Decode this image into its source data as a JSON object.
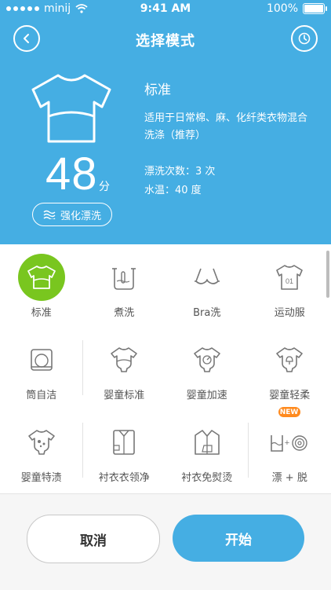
{
  "status_bar": {
    "carrier": "minij",
    "time": "9:41 AM",
    "battery": "100%"
  },
  "header": {
    "title": "选择模式"
  },
  "current_mode": {
    "name": "标准",
    "description": "适用于日常棉、麻、化纤类衣物混合洗涤（推荐）",
    "minutes": "48",
    "minutes_unit": "分",
    "boost_label": "强化漂洗",
    "rinse_count": "漂洗次数：3 次",
    "water_temp": "水温：40 度"
  },
  "modes": [
    {
      "label": "标准",
      "icon": "shirt-icon",
      "selected": true
    },
    {
      "label": "煮洗",
      "icon": "boil-pot-icon"
    },
    {
      "label": "Bra洗",
      "icon": "bra-icon"
    },
    {
      "label": "运动服",
      "icon": "jersey-icon"
    },
    {
      "label": "筒自洁",
      "icon": "drum-clean-icon"
    },
    {
      "label": "婴童标准",
      "icon": "baby-onesie-icon"
    },
    {
      "label": "婴童加速",
      "icon": "baby-onesie-fast-icon"
    },
    {
      "label": "婴童轻柔",
      "icon": "baby-onesie-gentle-icon"
    },
    {
      "label": "婴童特渍",
      "icon": "baby-onesie-stain-icon"
    },
    {
      "label": "衬衣衣领净",
      "icon": "shirt-collar-icon"
    },
    {
      "label": "衬衣免熨烫",
      "icon": "shirt-no-iron-icon"
    },
    {
      "label": "漂 + 脱",
      "icon": "rinse-spin-icon",
      "badge": "NEW"
    }
  ],
  "actions": {
    "cancel": "取消",
    "start": "开始"
  },
  "colors": {
    "primary": "#45aee3",
    "selected": "#79c61f",
    "badge": "#ff8a1e"
  }
}
